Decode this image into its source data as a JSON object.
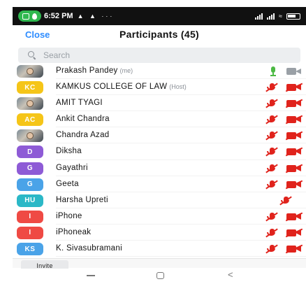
{
  "status_bar": {
    "time": "6:52 PM",
    "left_icons": "▲ ▲ ···"
  },
  "header": {
    "close_label": "Close",
    "title": "Participants (45)"
  },
  "search": {
    "placeholder": "Search"
  },
  "participants": [
    {
      "name": "Prakash Pandey",
      "tag": "(me)",
      "avatar": "",
      "avatar_type": "photo",
      "avatar_color": "",
      "mic": "unmuted",
      "cam": "on"
    },
    {
      "name": "KAMKUS COLLEGE OF LAW",
      "tag": "(Host)",
      "avatar": "KC",
      "avatar_type": "initials",
      "avatar_color": "#f5c518",
      "mic": "muted",
      "cam": "off"
    },
    {
      "name": "AMIT TYAGI",
      "tag": "",
      "avatar": "",
      "avatar_type": "photo",
      "avatar_color": "",
      "mic": "muted",
      "cam": "off"
    },
    {
      "name": "Ankit Chandra",
      "tag": "",
      "avatar": "AC",
      "avatar_type": "initials",
      "avatar_color": "#f5c518",
      "mic": "muted",
      "cam": "off"
    },
    {
      "name": "Chandra Azad",
      "tag": "",
      "avatar": "",
      "avatar_type": "photo",
      "avatar_color": "",
      "mic": "muted",
      "cam": "off"
    },
    {
      "name": "Diksha",
      "tag": "",
      "avatar": "D",
      "avatar_type": "initials",
      "avatar_color": "#8e5bd6",
      "mic": "muted",
      "cam": "off"
    },
    {
      "name": "Gayathri",
      "tag": "",
      "avatar": "G",
      "avatar_type": "initials",
      "avatar_color": "#8e5bd6",
      "mic": "muted",
      "cam": "off"
    },
    {
      "name": "Geeta",
      "tag": "",
      "avatar": "G",
      "avatar_type": "initials",
      "avatar_color": "#4aa3e8",
      "mic": "muted",
      "cam": "off"
    },
    {
      "name": "Harsha Upreti",
      "tag": "",
      "avatar": "HU",
      "avatar_type": "initials",
      "avatar_color": "#2bb8c7",
      "mic": "muted",
      "cam": "none"
    },
    {
      "name": "iPhone",
      "tag": "",
      "avatar": "I",
      "avatar_type": "initials",
      "avatar_color": "#ef4a44",
      "mic": "muted",
      "cam": "off"
    },
    {
      "name": "iPhoneak",
      "tag": "",
      "avatar": "I",
      "avatar_type": "initials",
      "avatar_color": "#ef4a44",
      "mic": "muted",
      "cam": "off"
    },
    {
      "name": "K. Sivasubramani",
      "tag": "",
      "avatar": "KS",
      "avatar_type": "initials",
      "avatar_color": "#4aa3e8",
      "mic": "muted",
      "cam": "off"
    }
  ],
  "footer": {
    "invite_label": "Invite"
  },
  "colors": {
    "accent": "#2d8cff",
    "muted_red": "#e0231c",
    "unmuted_green": "#4cb944"
  }
}
